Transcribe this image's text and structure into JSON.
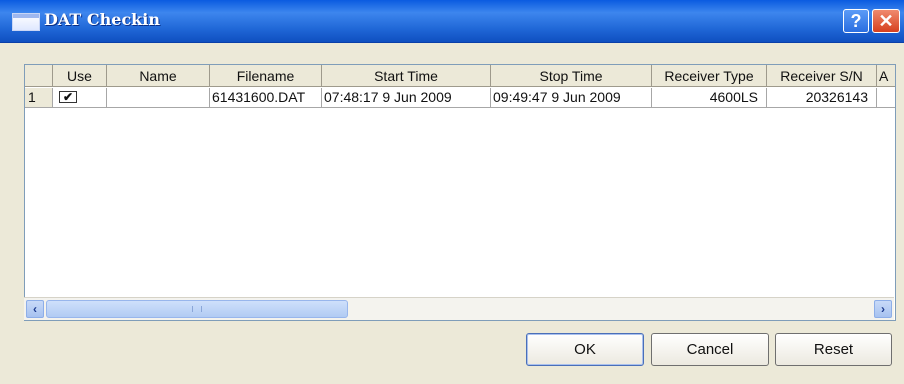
{
  "window": {
    "title": "DAT Checkin"
  },
  "titlebar_buttons": {
    "help": "?",
    "close": "✕"
  },
  "table": {
    "columns": [
      "Use",
      "Name",
      "Filename",
      "Start Time",
      "Stop Time",
      "Receiver Type",
      "Receiver S/N",
      "A"
    ],
    "rows": [
      {
        "row_number": "1",
        "use_checked": true,
        "use_mark": "✔",
        "name": "",
        "filename": "61431600.DAT",
        "start_time": "07:48:17 9 Jun 2009",
        "stop_time": "09:49:47 9 Jun 2009",
        "receiver_type": "4600LS",
        "receiver_sn": "20326143",
        "a": ""
      }
    ]
  },
  "scrollbar": {
    "left_arrow": "‹",
    "right_arrow": "›"
  },
  "buttons": {
    "ok": "OK",
    "cancel": "Cancel",
    "reset": "Reset"
  },
  "colors": {
    "titlebar": "#1f66d6",
    "window_bg": "#ece9d8",
    "close": "#d6401f"
  }
}
